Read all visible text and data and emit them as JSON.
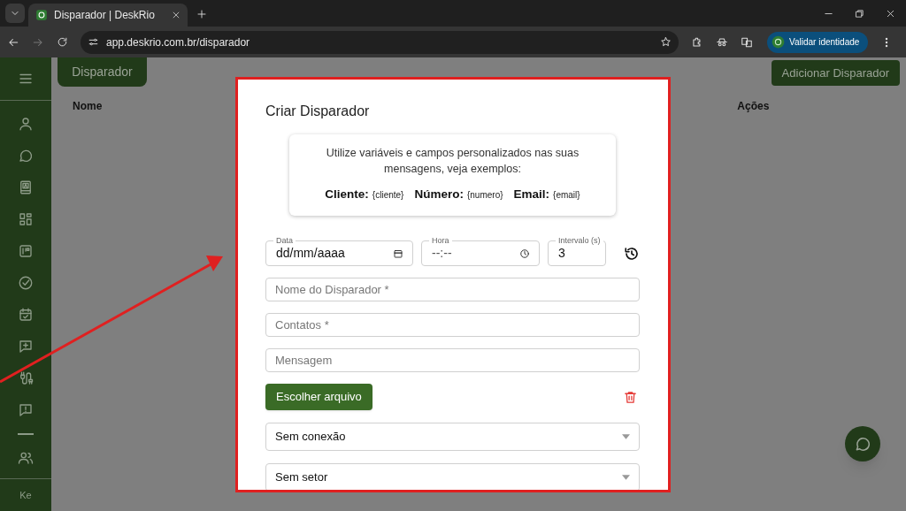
{
  "browser": {
    "tab_title": "Disparador | DeskRio",
    "url": "app.deskrio.com.br/disparador",
    "profile_button": "Validar identidade"
  },
  "sidebar": {
    "user_initials": "Ke"
  },
  "page": {
    "title": "Disparador",
    "add_button": "Adicionar Disparador",
    "columns": [
      "Nome",
      "Ações"
    ]
  },
  "dialog": {
    "title": "Criar Disparador",
    "info": {
      "text": "Utilize variáveis e campos personalizados nas suas mensagens, veja exemplos:",
      "variables": [
        {
          "label": "Cliente:",
          "value": "{cliente}"
        },
        {
          "label": "Número:",
          "value": "{numero}"
        },
        {
          "label": "Email:",
          "value": "{email}"
        }
      ]
    },
    "schedule": [
      {
        "kind": "date",
        "label": "Data",
        "value": "dd/mm/aaaa"
      },
      {
        "kind": "time",
        "label": "Hora",
        "value": "--:--"
      },
      {
        "kind": "number",
        "label": "Intervalo (s)",
        "value": "3"
      }
    ],
    "fields": [
      {
        "placeholder": "Nome do Disparador *"
      },
      {
        "placeholder": "Contatos *"
      },
      {
        "placeholder": "Mensagem"
      }
    ],
    "file_button": "Escolher arquivo",
    "selects": [
      {
        "value": "Sem conexão"
      },
      {
        "value": "Sem setor"
      }
    ]
  }
}
